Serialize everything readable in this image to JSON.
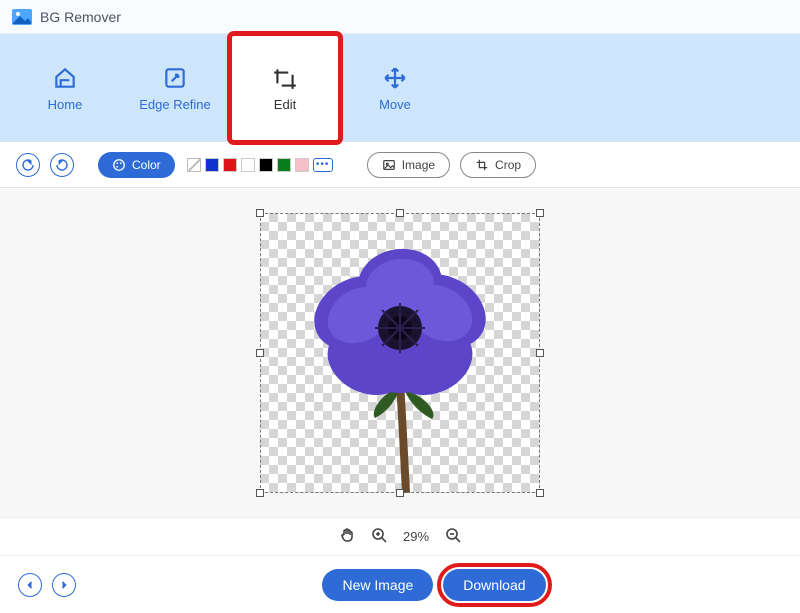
{
  "app": {
    "title": "BG Remover"
  },
  "nav": {
    "home": {
      "label": "Home"
    },
    "edge": {
      "label": "Edge Refine"
    },
    "edit": {
      "label": "Edit"
    },
    "move": {
      "label": "Move"
    }
  },
  "toolbar": {
    "color_label": "Color",
    "image_label": "Image",
    "crop_label": "Crop",
    "swatches": [
      "none",
      "#1030d0",
      "#e01414",
      "#ffffff",
      "#000000",
      "#0a7d1f",
      "#f7c0c8"
    ],
    "more_swatches": "•••"
  },
  "zoom": {
    "level": "29%"
  },
  "footer": {
    "new_image": "New Image",
    "download": "Download"
  }
}
